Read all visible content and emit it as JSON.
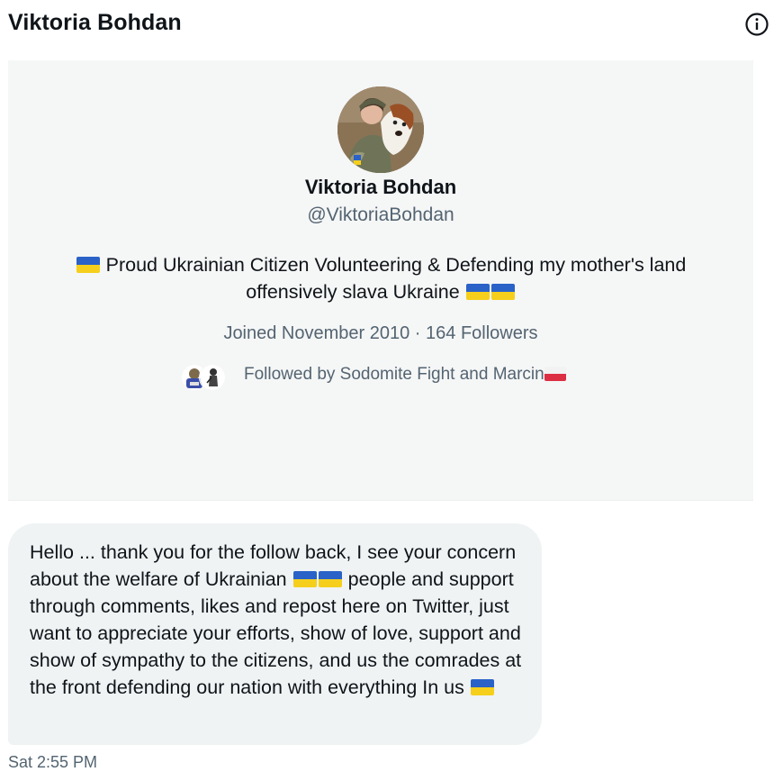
{
  "header": {
    "title": "Viktoria Bohdan",
    "info_icon": "info-circle-icon"
  },
  "profile": {
    "name": "Viktoria Bohdan",
    "handle": "@ViktoriaBohdan",
    "bio_line1": "Proud Ukrainian Citizen Volunteering & Defending my mother's land",
    "bio_line2": "offensively slava Ukraine",
    "joined": "Joined November 2010",
    "separator": "·",
    "followers": "164 Followers",
    "followed_by": "Followed by Sodomite Fight and Marcin"
  },
  "message": {
    "text_part1": "Hello ... thank you for the follow back, I see your concern about the welfare of Ukrainian",
    "text_part2": "people and support through comments, likes and repost here on Twitter, just want to appreciate your efforts, show of love, support and show of sympathy to the citizens, and us the comrades at the front defending our nation with everything In us",
    "timestamp": "Sat 2:55 PM"
  },
  "colors": {
    "ukraine_blue": "#2a62c8",
    "ukraine_yellow": "#f5cf1c",
    "poland_white": "#f2f2f2",
    "poland_red": "#dc2f44",
    "secondary_text": "#536471"
  }
}
